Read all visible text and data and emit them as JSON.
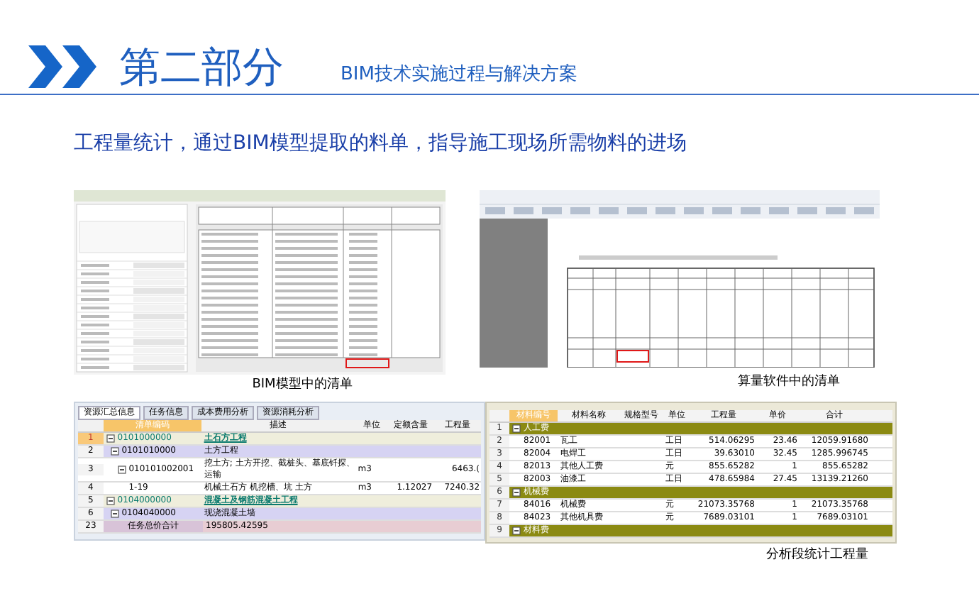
{
  "header": {
    "title": "第二部分",
    "subtitle": "BIM技术实施过程与解决方案"
  },
  "lead": "工程量统计，通过BIM模型提取的料单，指导施工现场所需物料的进场",
  "figures": [
    {
      "caption": "BIM模型中的清单"
    },
    {
      "caption": "算量软件中的清单"
    }
  ],
  "task_table": {
    "tabs": [
      {
        "label": "资源汇总信息",
        "selected": true
      },
      {
        "label": "任务信息",
        "selected": false
      },
      {
        "label": "成本费用分析",
        "selected": false
      },
      {
        "label": "资源消耗分析",
        "selected": false
      }
    ],
    "columns": [
      "清单编码",
      "描述",
      "单位",
      "定额含量",
      "工程量"
    ],
    "rows": [
      {
        "num": "1",
        "kind": "section",
        "selected": true,
        "cells": [
          "0101000000",
          "土石方工程",
          "",
          "",
          ""
        ]
      },
      {
        "num": "2",
        "kind": "subsection",
        "selected": false,
        "cells": [
          "0101010000",
          "土方工程",
          "",
          "",
          ""
        ]
      },
      {
        "num": "3",
        "kind": "item",
        "selected": false,
        "cells": [
          "010101002001",
          "挖土方; 土方开挖、截桩头、基底钎探、运输",
          "m3",
          "",
          "6463.("
        ]
      },
      {
        "num": "4",
        "kind": "leaf",
        "selected": false,
        "cells": [
          "1-19",
          "机械土石方 机挖槽、坑 土方",
          "m3",
          "1.12027",
          "7240.32"
        ]
      },
      {
        "num": "5",
        "kind": "section",
        "selected": false,
        "cells": [
          "0104000000",
          "混凝土及钢筋混凝土工程",
          "",
          "",
          ""
        ]
      },
      {
        "num": "6",
        "kind": "subsection",
        "selected": false,
        "cells": [
          "0104040000",
          "现浇混凝土墙",
          "",
          "",
          ""
        ]
      },
      {
        "num": "23",
        "kind": "total",
        "selected": false,
        "cells": [
          "任务总价合计",
          "195805.42595",
          "",
          "",
          ""
        ]
      }
    ]
  },
  "material_table": {
    "columns": [
      "材料编号",
      "材料名称",
      "规格型号",
      "单位",
      "工程量",
      "单价",
      "合计"
    ],
    "rows": [
      {
        "num": "1",
        "kind": "group",
        "cells": [
          "人工费",
          "",
          "",
          "",
          "",
          "",
          ""
        ]
      },
      {
        "num": "2",
        "kind": "item",
        "cells": [
          "82001",
          "瓦工",
          "",
          "工日",
          "514.06295",
          "23.46",
          "12059.91680"
        ]
      },
      {
        "num": "3",
        "kind": "item",
        "cells": [
          "82004",
          "电焊工",
          "",
          "工日",
          "39.63010",
          "32.45",
          "1285.996745"
        ]
      },
      {
        "num": "4",
        "kind": "item",
        "cells": [
          "82013",
          "其他人工费",
          "",
          "元",
          "855.65282",
          "1",
          "855.65282"
        ]
      },
      {
        "num": "5",
        "kind": "item",
        "cells": [
          "82003",
          "油漆工",
          "",
          "工日",
          "478.65984",
          "27.45",
          "13139.21260"
        ]
      },
      {
        "num": "6",
        "kind": "group",
        "cells": [
          "机械费",
          "",
          "",
          "",
          "",
          "",
          ""
        ]
      },
      {
        "num": "7",
        "kind": "item",
        "cells": [
          "84016",
          "机械费",
          "",
          "元",
          "21073.35768",
          "1",
          "21073.35768"
        ]
      },
      {
        "num": "8",
        "kind": "item",
        "cells": [
          "84023",
          "其他机具费",
          "",
          "元",
          "7689.03101",
          "1",
          "7689.03101"
        ]
      },
      {
        "num": "9",
        "kind": "group",
        "cells": [
          "材料费",
          "",
          "",
          "",
          "",
          "",
          ""
        ]
      }
    ],
    "caption": "分析段统计工程量"
  }
}
